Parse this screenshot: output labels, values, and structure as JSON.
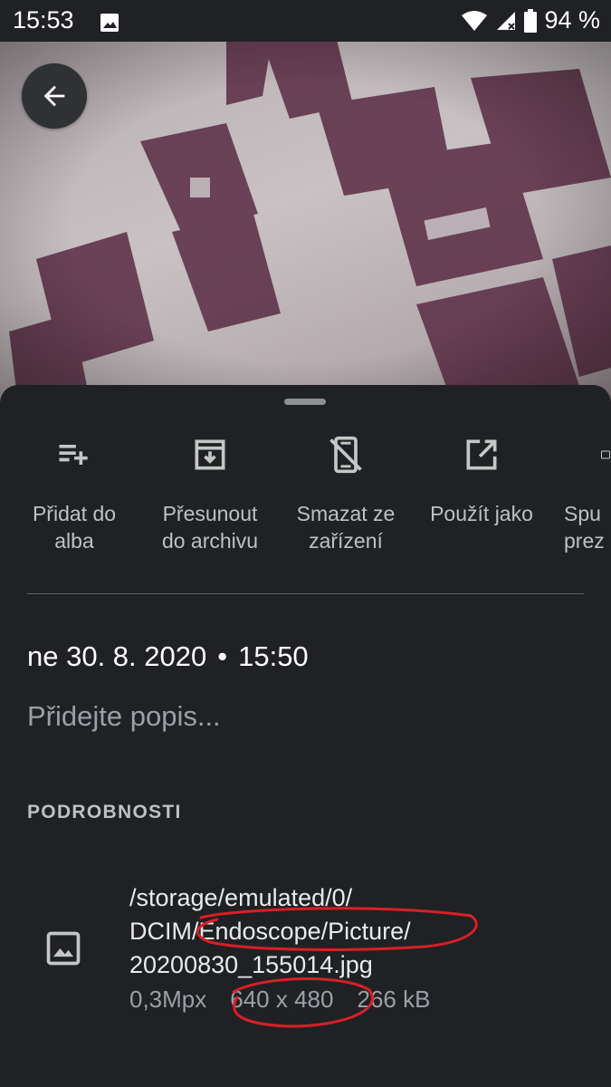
{
  "status_bar": {
    "time": "15:53",
    "battery": "94 %",
    "icons": [
      "image-notification-icon",
      "wifi-icon",
      "cell-signal-icon",
      "battery-icon"
    ]
  },
  "photo": {
    "description_icon": "photo-preview"
  },
  "back_button": {
    "icon": "arrow-left-icon"
  },
  "actions": [
    {
      "icon": "playlist-add-icon",
      "line1": "Přidat do",
      "line2": "alba"
    },
    {
      "icon": "archive-icon",
      "line1": "Přesunout",
      "line2": "do archivu"
    },
    {
      "icon": "mobile-off-icon",
      "line1": "Smazat ze",
      "line2": "zařízení"
    },
    {
      "icon": "open-in-new-icon",
      "line1": "Použít jako",
      "line2": ""
    },
    {
      "icon": "slideshow-icon",
      "line1": "Spu",
      "line2": "prez"
    }
  ],
  "details": {
    "date": "ne 30. 8. 2020",
    "separator": "•",
    "time": "15:50",
    "description_placeholder": "Přidejte popis...",
    "section_title": "PODROBNOSTI",
    "file": {
      "path_line1": "/storage/emulated/0/",
      "path_line2": "DCIM/Endoscope/Picture/",
      "path_line3": "20200830_155014.jpg",
      "megapixels": "0,3Mpx",
      "resolution": "640 x 480",
      "size": "266 kB"
    }
  },
  "colors": {
    "background": "#202124",
    "annotation": "#d81f26",
    "secondary_text": "#9aa0a6"
  }
}
